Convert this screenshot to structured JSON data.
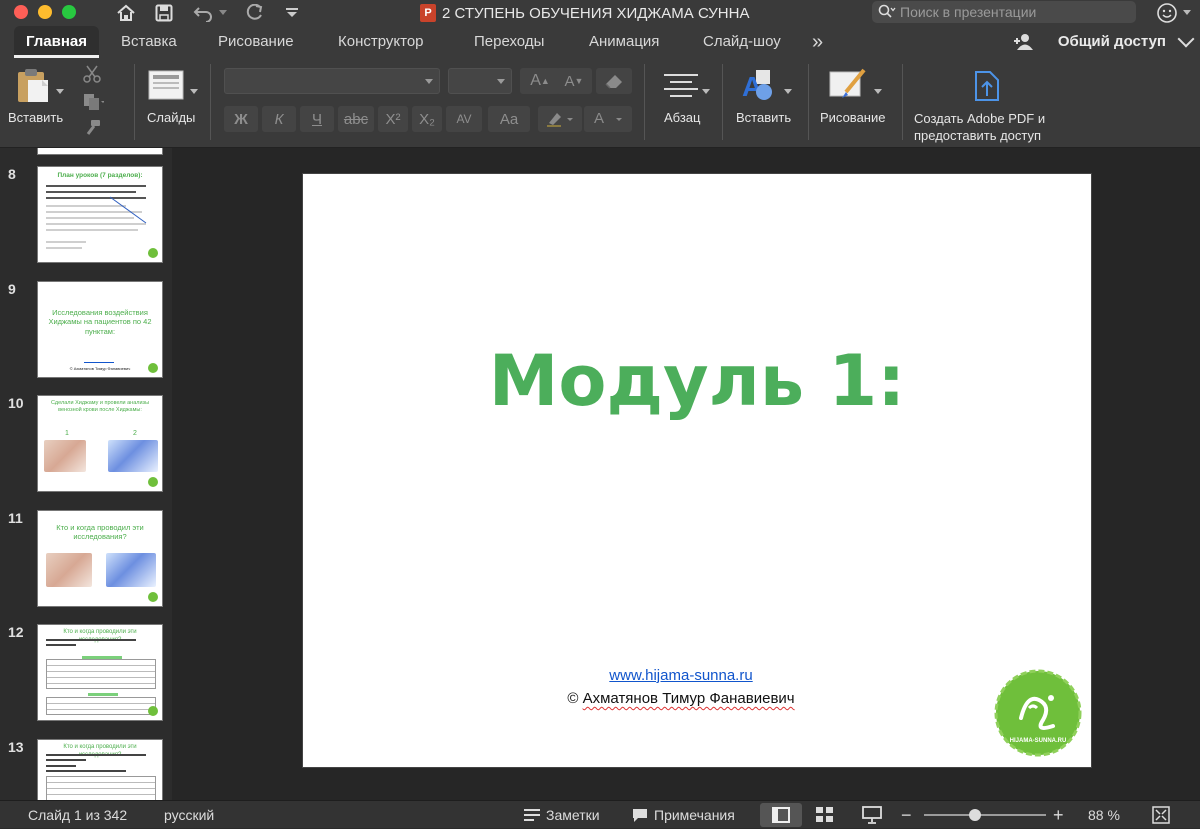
{
  "window": {
    "title": "2 СТУПЕНЬ ОБУЧЕНИЯ ХИДЖАМА СУННА",
    "app_badge": "P",
    "search_placeholder": "Поиск в презентации"
  },
  "tabs": [
    {
      "label": "Главная",
      "active": true
    },
    {
      "label": "Вставка"
    },
    {
      "label": "Рисование"
    },
    {
      "label": "Конструктор"
    },
    {
      "label": "Переходы"
    },
    {
      "label": "Анимация"
    },
    {
      "label": "Слайд-шоу"
    }
  ],
  "tabs_more": "»",
  "share_label": "Общий доступ",
  "ribbon": {
    "paste": "Вставить",
    "slides": "Слайды",
    "paragraph": "Абзац",
    "insert": "Вставить",
    "drawing": "Рисование",
    "adobe_line1": "Создать Adobe PDF и",
    "adobe_line2": "предоставить доступ",
    "format_buttons": [
      "Ж",
      "К",
      "Ч",
      "abc",
      "X²",
      "X₂",
      "AV",
      "Aa"
    ]
  },
  "thumbnails": [
    {
      "number": "8",
      "title": "План уроков (7 разделов):"
    },
    {
      "number": "9",
      "title": "Исследования воздействия Хиджамы на пациентов по 42 пунктам:",
      "small": "© Ахматянов Тимур Фанавиевич"
    },
    {
      "number": "10",
      "title": "Сделали Хиджаму и провели анализы венозной крови после Хиджамы:",
      "label1": "1",
      "label2": "2"
    },
    {
      "number": "11",
      "title": "Кто и когда проводил эти исследования?"
    },
    {
      "number": "12",
      "title": "Кто и когда проводили эти исследования?"
    },
    {
      "number": "13",
      "title": "Кто и когда проводили эти исследования?"
    }
  ],
  "slide": {
    "title": "Модуль 1:",
    "url": "www.hijama-sunna.ru",
    "copyright_prefix": "© ",
    "copyright_name": "Ахматянов Тимур Фанавиевич",
    "logo_text": "HIJAMA-SUNNA.RU"
  },
  "status": {
    "slide_counter": "Слайд 1 из 342",
    "language": "русский",
    "notes": "Заметки",
    "comments": "Примечания",
    "zoom": "88 %"
  },
  "colors": {
    "accent_green": "#4cae5b",
    "link_blue": "#1155cc",
    "chrome_dark": "#3a3a3a"
  }
}
